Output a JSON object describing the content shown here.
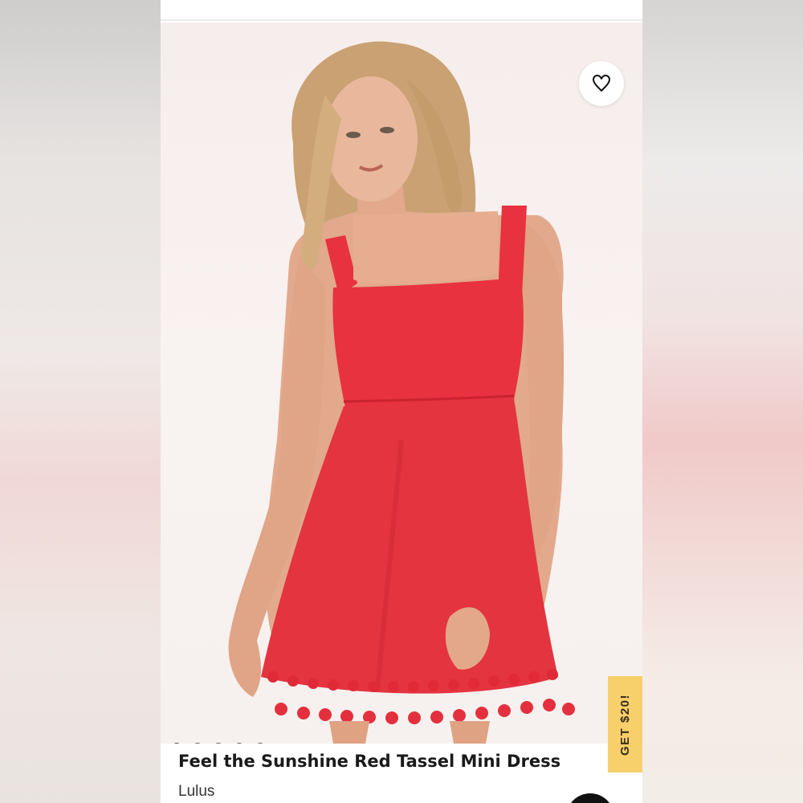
{
  "product": {
    "title": "Feel the Sunshine Red Tassel Mini Dress",
    "brand": "Lulus",
    "image_dots": [
      {
        "active": true
      },
      {
        "active": false
      },
      {
        "active": false
      },
      {
        "active": false
      },
      {
        "active": false
      }
    ]
  },
  "favorite": {
    "icon": "heart-icon"
  },
  "promo": {
    "label": "GET $20!",
    "color": "#f7cf6b"
  },
  "colors": {
    "dress": "#e8323f"
  }
}
